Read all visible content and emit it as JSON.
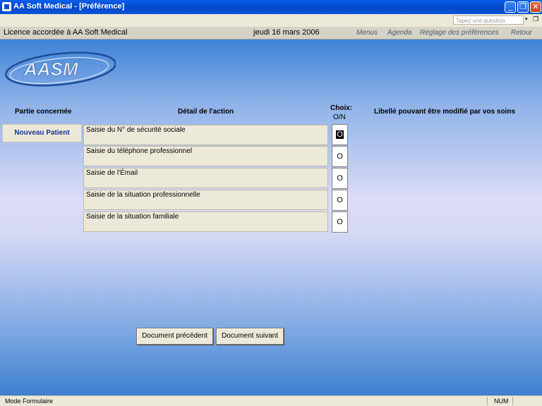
{
  "window": {
    "title": "AA Soft Medical - [Préférence]",
    "minimize": "_",
    "restore": "❐",
    "close": "✕"
  },
  "menubar": {
    "question_placeholder": "Tapez une question",
    "dropdown_arrow": "▾",
    "restore_glyph": "❐"
  },
  "nav": {
    "licence": "Licence accordée à AA Soft Medical",
    "date": "jeudi 16 mars 2006",
    "links": [
      "Menus",
      "Agenda",
      "Réglage des préférences",
      "Retour"
    ]
  },
  "logo": {
    "text": "AASM"
  },
  "headers": {
    "partie": "Partie concernée",
    "detail": "Détail de l'action",
    "choix_line1": "Choix:",
    "choix_line2": "O/N",
    "libelle": "Libellé pouvant être modifié par vos soins"
  },
  "partie_button": "Nouveau Patient",
  "actions": [
    {
      "label": "Saisie du N° de sécurité sociale",
      "choice": "O"
    },
    {
      "label": "Saisie du téléphone professionnel",
      "choice": "O"
    },
    {
      "label": "Saisie de l'Émail",
      "choice": "O"
    },
    {
      "label": "Saisie de la situation professionnelle",
      "choice": "O"
    },
    {
      "label": "Saisie de la situation familiale",
      "choice": "O"
    }
  ],
  "buttons": {
    "previous": "Document précédent",
    "next": "Document suivant"
  },
  "status": {
    "mode": "Mode Formulaire",
    "num": "NUM"
  },
  "colors": {
    "titlebar": "#0347c8",
    "partie_text": "#1b2f97",
    "nav_link": "#475a74"
  }
}
